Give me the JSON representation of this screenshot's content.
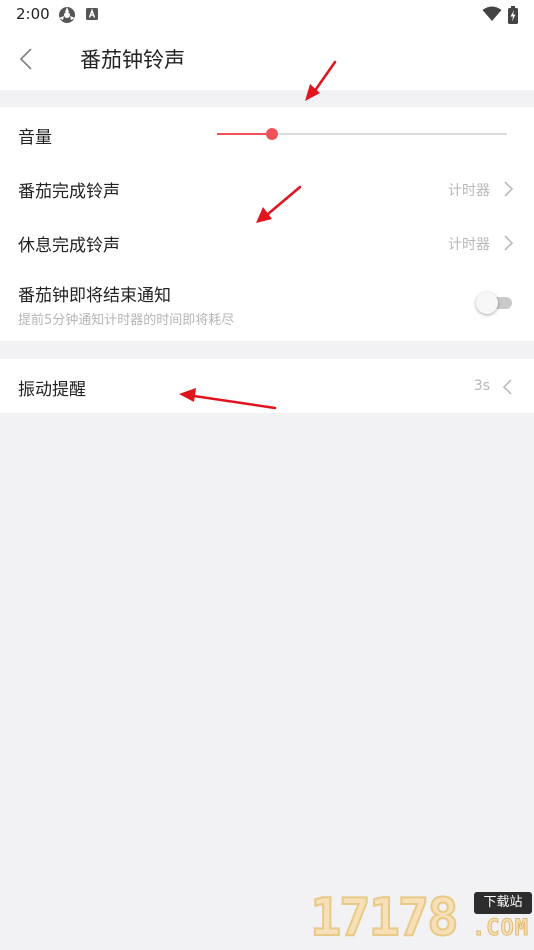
{
  "status_bar": {
    "time": "2:00",
    "icons": [
      "settings-wheel-icon",
      "app-badge-icon",
      "wifi-icon",
      "battery-charging-icon"
    ]
  },
  "header": {
    "title": "番茄钟铃声",
    "back_icon": "chevron-left-icon"
  },
  "settings": {
    "volume": {
      "label": "音量",
      "level": 0.19,
      "accent": "#f0525a"
    },
    "pomodoro_ringtone": {
      "label": "番茄完成铃声",
      "value": "计时器"
    },
    "break_ringtone": {
      "label": "休息完成铃声",
      "value": "计时器"
    },
    "ending_notice": {
      "label": "番茄钟即将结束通知",
      "description": "提前5分钟通知计时器的时间即将耗尽",
      "enabled": false
    },
    "vibration": {
      "label": "振动提醒",
      "value": "3s"
    }
  },
  "annotation_color": "#e0141c",
  "watermark": {
    "digits": "17178",
    "badge": "下载站",
    "suffix": ".COM"
  }
}
